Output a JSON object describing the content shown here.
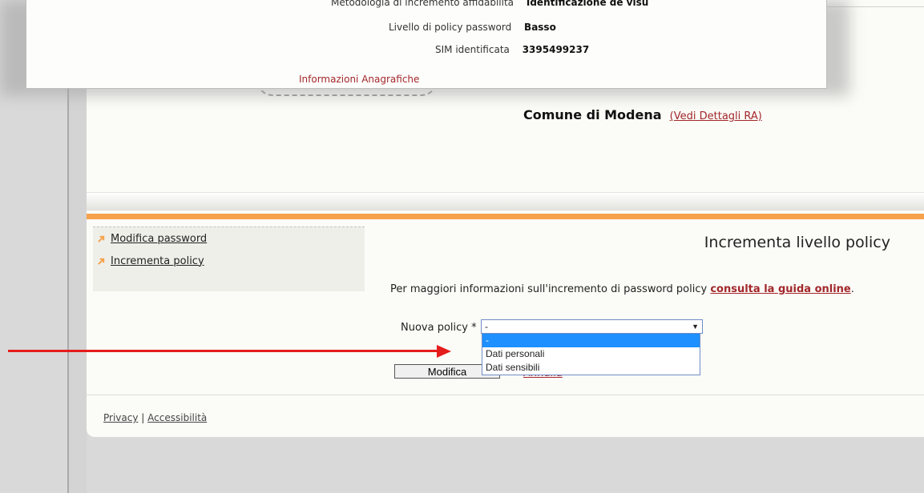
{
  "popup": {
    "rows": [
      {
        "label": "Metodologia di incremento affidabilità",
        "value": "Identificazione de visu"
      },
      {
        "label": "Livello di policy password",
        "value": "Basso"
      },
      {
        "label": "SIM identificata",
        "value": "3395499237"
      }
    ],
    "link": "Informazioni Anagrafiche"
  },
  "header": {
    "org_name": "Comune di Modena",
    "org_link": "(Vedi Dettagli RA)"
  },
  "sidebar": {
    "items": [
      {
        "label": "Modifica password"
      },
      {
        "label": "Incrementa policy"
      }
    ]
  },
  "main": {
    "title": "Incrementa livello policy",
    "info_prefix": "Per maggiori informazioni sull'incremento di password policy ",
    "info_link": "consulta la guida online",
    "info_suffix": ".",
    "policy_label": "Nuova policy *",
    "policy_selected": "-",
    "policy_options": [
      "-",
      "Dati personali",
      "Dati sensibili"
    ],
    "submit_label": "Modifica",
    "cancel_label": "Annulla"
  },
  "footer": {
    "privacy": "Privacy",
    "separator": "|",
    "accessibility": "Accessibilità"
  },
  "colors": {
    "accent_orange": "#f6a14b",
    "link_red": "#a2272b",
    "annotation_arrow": "#e51c1c",
    "option_highlight": "#1e90ff"
  }
}
